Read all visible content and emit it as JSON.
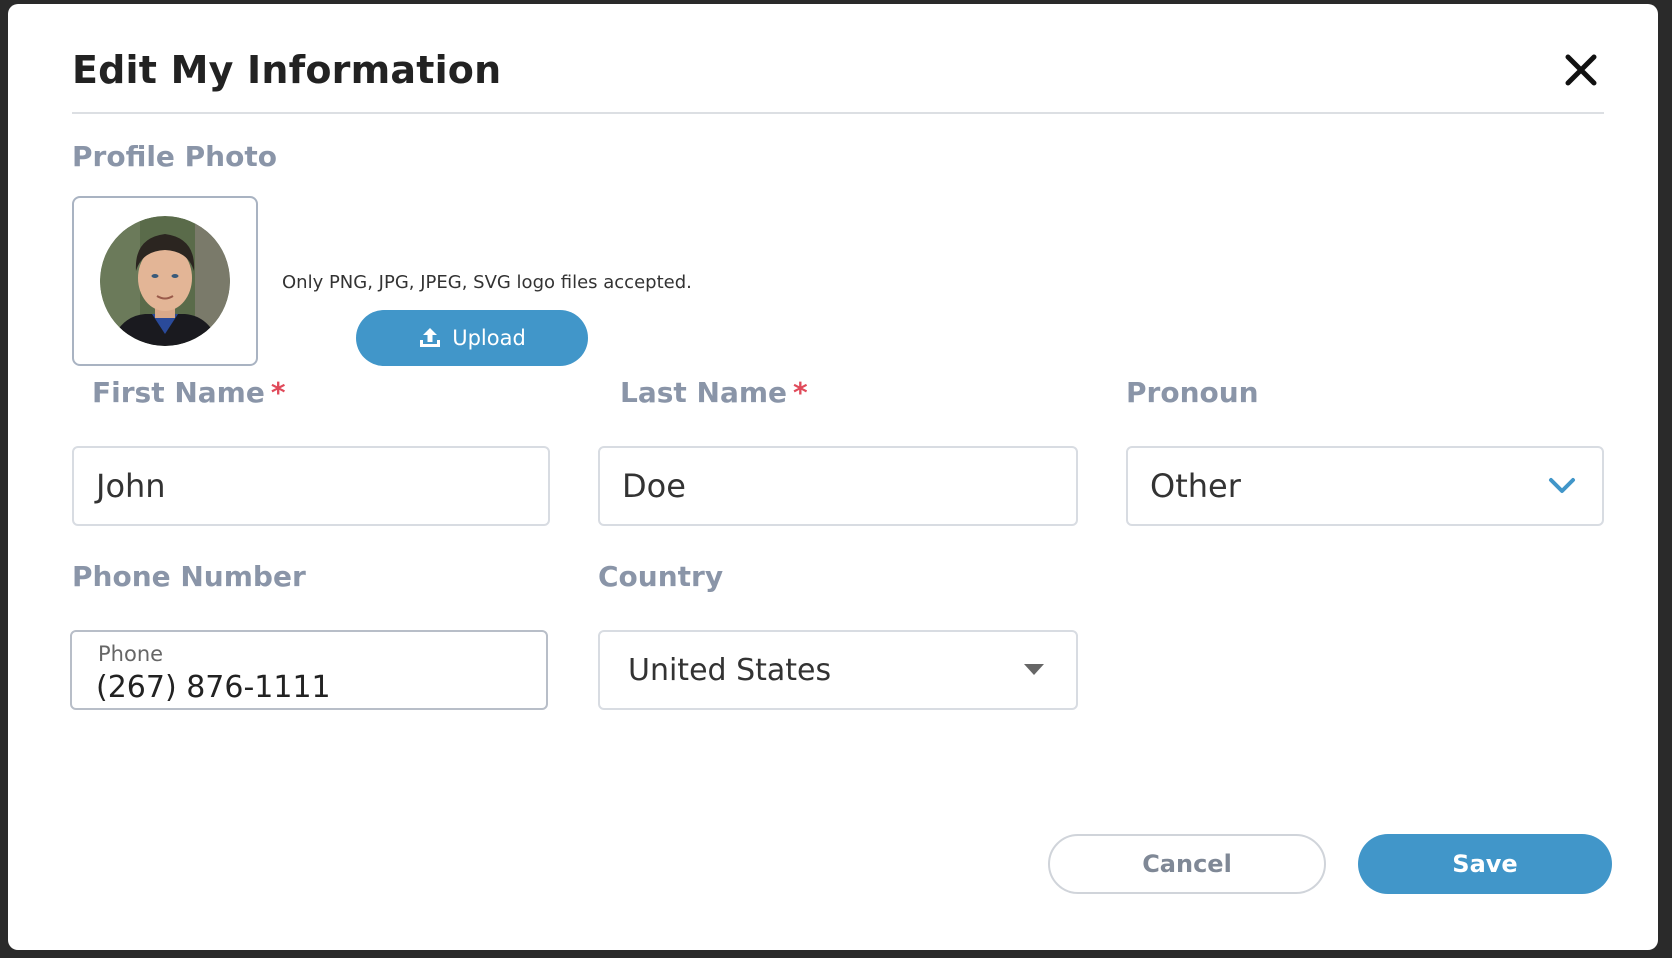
{
  "dialog": {
    "title": "Edit My Information",
    "close_icon": "close-icon"
  },
  "profile_photo": {
    "label": "Profile Photo",
    "hint": "Only PNG, JPG, JPEG, SVG logo files accepted.",
    "upload_label": "Upload",
    "upload_icon": "upload-icon"
  },
  "fields": {
    "first_name": {
      "label": "First Name",
      "required_mark": "*",
      "value": "John"
    },
    "last_name": {
      "label": "Last Name",
      "required_mark": "*",
      "value": "Doe"
    },
    "pronoun": {
      "label": "Pronoun",
      "value": "Other",
      "icon": "chevron-down-icon"
    },
    "phone": {
      "label": "Phone Number",
      "inner_label": "Phone",
      "value": "(267) 876-1111"
    },
    "country": {
      "label": "Country",
      "value": "United States",
      "icon": "caret-down-icon"
    }
  },
  "actions": {
    "cancel_label": "Cancel",
    "save_label": "Save"
  },
  "colors": {
    "primary": "#4196c9",
    "label": "#8a95a8",
    "required": "#e04a5a"
  }
}
